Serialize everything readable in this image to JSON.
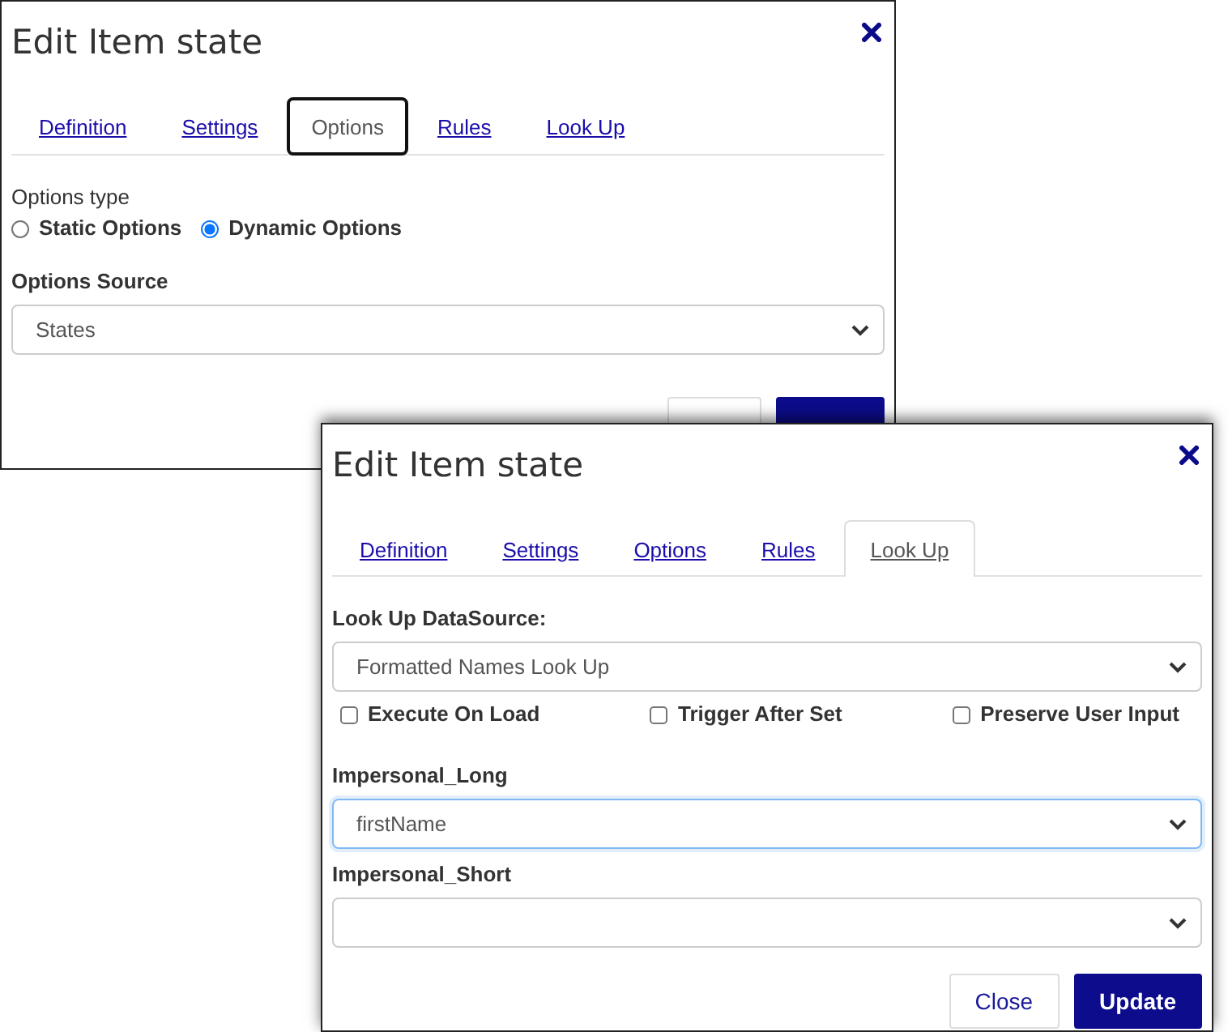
{
  "dialogs": [
    {
      "title": "Edit Item state",
      "tabs": [
        {
          "label": "Definition",
          "selected": false,
          "focused": false
        },
        {
          "label": "Settings",
          "selected": false,
          "focused": false
        },
        {
          "label": "Options",
          "selected": true,
          "focused": true
        },
        {
          "label": "Rules",
          "selected": false,
          "focused": false
        },
        {
          "label": "Look Up",
          "selected": false,
          "focused": false
        }
      ],
      "sections": [
        {
          "kind": "radio_group",
          "label": "Options type",
          "options": [
            {
              "label": "Static Options",
              "selected": false
            },
            {
              "label": "Dynamic Options",
              "selected": true
            }
          ]
        },
        {
          "kind": "select",
          "label": "Options Source",
          "value": "States",
          "focused": false
        }
      ],
      "buttons": [
        {
          "kind": "secondary"
        },
        {
          "kind": "primary"
        }
      ]
    },
    {
      "title": "Edit Item state",
      "tabs": [
        {
          "label": "Definition",
          "selected": false,
          "focused": false
        },
        {
          "label": "Settings",
          "selected": false,
          "focused": false
        },
        {
          "label": "Options",
          "selected": false,
          "focused": false
        },
        {
          "label": "Rules",
          "selected": false,
          "focused": false
        },
        {
          "label": "Look Up",
          "selected": true,
          "focused": false
        }
      ],
      "sections": [
        {
          "kind": "select",
          "label": "Look Up DataSource:",
          "value": "Formatted Names Look Up",
          "focused": false
        },
        {
          "kind": "checkboxes",
          "items": [
            {
              "label": "Execute On Load",
              "checked": false
            },
            {
              "label": "Trigger After Set",
              "checked": false
            },
            {
              "label": "Preserve User Input",
              "checked": false
            }
          ]
        },
        {
          "kind": "select",
          "label": "Impersonal_Long",
          "value": "firstName",
          "focused": true
        },
        {
          "kind": "select",
          "label": "Impersonal_Short",
          "focused": false
        }
      ],
      "buttons": [
        {
          "label": "Close",
          "kind": "secondary"
        },
        {
          "label": "Update",
          "kind": "primary"
        }
      ]
    }
  ]
}
